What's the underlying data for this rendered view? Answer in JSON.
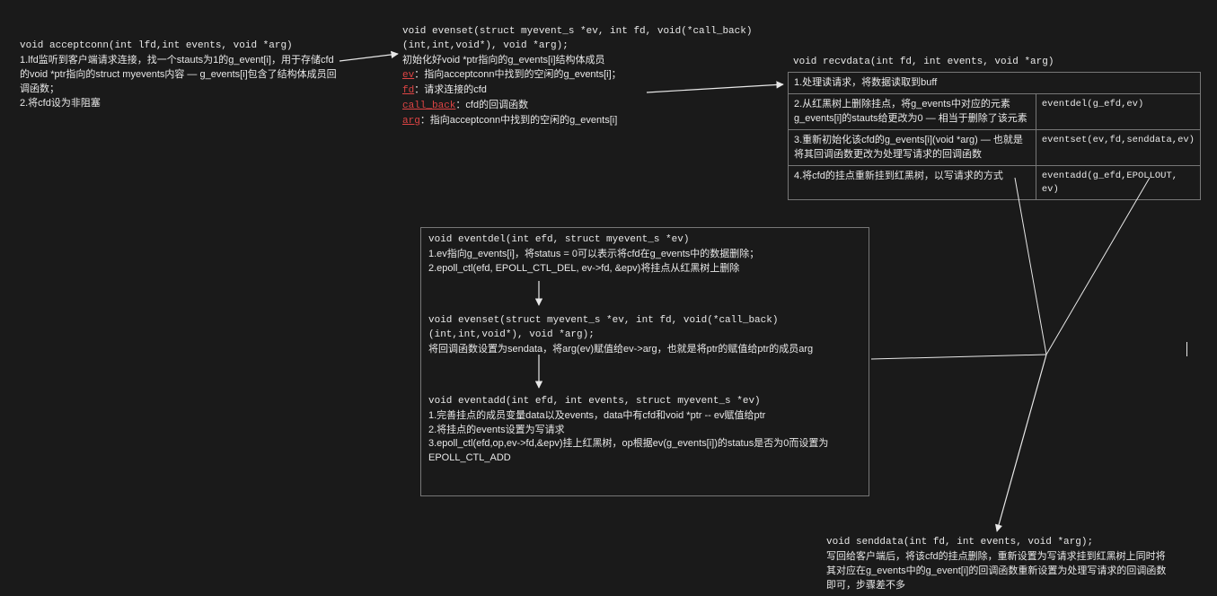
{
  "acceptconn": {
    "sig": "void acceptconn(int lfd,int events, void *arg)",
    "l1": "1.lfd监听到客户端请求连接，找一个stauts为1的g_event[i]，用于存储cfd的void *ptr指向的struct myevents内容 — g_events[i]包含了结构体成员回调函数；",
    "l2": "2.将cfd设为非阻塞"
  },
  "evenset": {
    "sig": "void evenset(struct myevent_s *ev, int fd, void(*call_back)(int,int,void*), void *arg);",
    "sub": "初始化好void *ptr指向的g_events[i]结构体成员",
    "ev_label": "ev",
    "ev_text": "：指向acceptconn中找到的空闲的g_events[i]；",
    "fd_label": "fd",
    "fd_text": "：请求连接的cfd",
    "cb_label": "call_back",
    "cb_text": "：cfd的回调函数",
    "arg_label": "arg",
    "arg_text": "：指向acceptconn中找到的空闲的g_events[i]"
  },
  "recvdata": {
    "sig": "void recvdata(int fd, int events, void *arg)",
    "row1a": "1.处理读请求，将数据读取到buff",
    "row2a": "2.从红黑树上删除挂点，将g_events中对应的元素g_events[i]的stauts给更改为0 — 相当于删除了该元素",
    "row2b": "eventdel(g_efd,ev)",
    "row3a": "3.重新初始化该cfd的g_events[i](void *arg) — 也就是将其回调函数更改为处理写请求的回调函数",
    "row3b": "eventset(ev,fd,senddata,ev)",
    "row4a": "4.将cfd的挂点重新挂到红黑树，以写请求的方式",
    "row4b": "eventadd(g_efd,EPOLLOUT, ev)"
  },
  "eventdel": {
    "sig": "void eventdel(int efd, struct myevent_s *ev)",
    "l1": "1.ev指向g_events[i]，将status = 0可以表示将cfd在g_events中的数据删除；",
    "l2": "2.epoll_ctl(efd, EPOLL_CTL_DEL, ev->fd, &epv)将挂点从红黑树上删除"
  },
  "evenset2": {
    "sig": "void evenset(struct myevent_s *ev, int fd, void(*call_back)(int,int,void*), void *arg);",
    "l1": "将回调函数设置为sendata，将arg(ev)赋值给ev->arg，也就是将ptr的赋值给ptr的成员arg"
  },
  "eventadd": {
    "sig": "void eventadd(int efd, int events, struct myevent_s *ev)",
    "l1": "1.完善挂点的成员变量data以及events，data中有cfd和void *ptr -- ev赋值给ptr",
    "l2": "2.将挂点的events设置为写请求",
    "l3": "3.epoll_ctl(efd,op,ev->fd,&epv)挂上红黑树，op根据ev(g_events[i])的status是否为0而设置为EPOLL_CTL_ADD"
  },
  "senddata": {
    "sig": "void senddata(int fd, int events, void *arg);",
    "l1": "写回给客户端后，将该cfd的挂点删除，重新设置为写请求挂到红黑树上同时将其对应在g_events中的g_event[i]的回调函数重新设置为处理写请求的回调函数即可，步骤差不多"
  }
}
